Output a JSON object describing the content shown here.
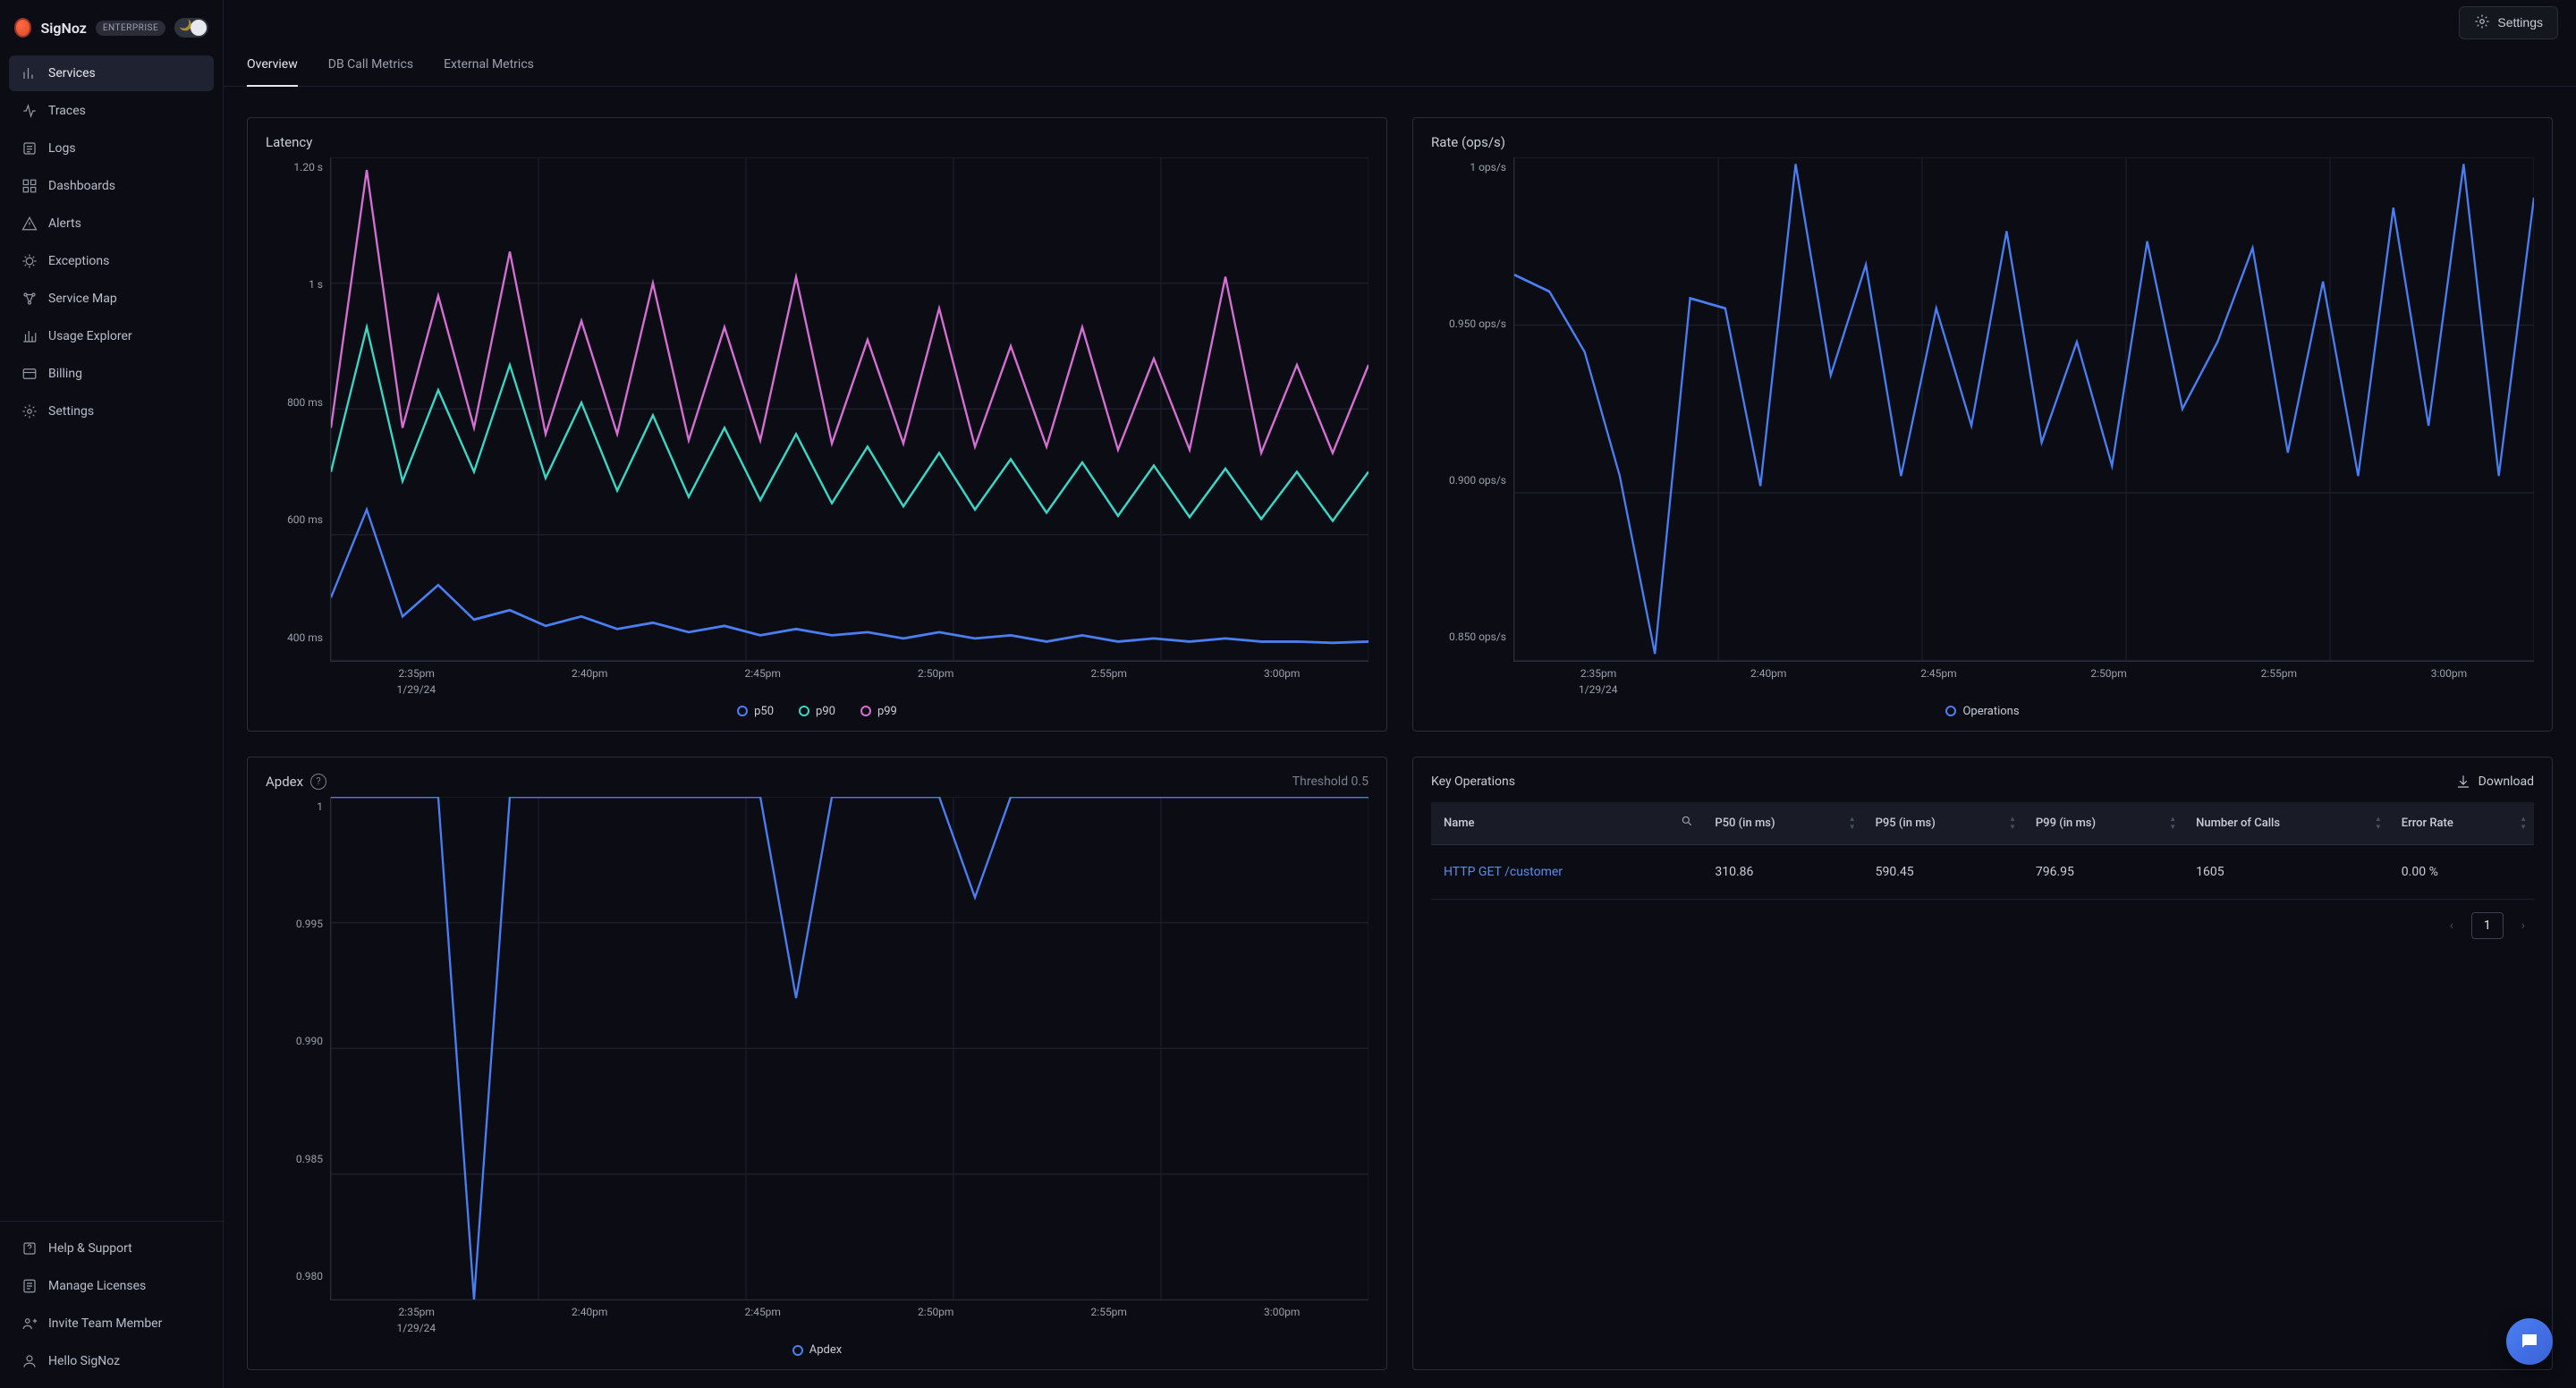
{
  "brand": {
    "name": "SigNoz",
    "badge": "ENTERPRISE"
  },
  "sidebar": {
    "items": [
      {
        "label": "Services",
        "icon": "bar-chart-icon",
        "active": true
      },
      {
        "label": "Traces",
        "icon": "traces-icon",
        "active": false
      },
      {
        "label": "Logs",
        "icon": "logs-icon",
        "active": false
      },
      {
        "label": "Dashboards",
        "icon": "grid-icon",
        "active": false
      },
      {
        "label": "Alerts",
        "icon": "alert-icon",
        "active": false
      },
      {
        "label": "Exceptions",
        "icon": "bug-icon",
        "active": false
      },
      {
        "label": "Service Map",
        "icon": "map-icon",
        "active": false
      },
      {
        "label": "Usage Explorer",
        "icon": "usage-icon",
        "active": false
      },
      {
        "label": "Billing",
        "icon": "billing-icon",
        "active": false
      },
      {
        "label": "Settings",
        "icon": "gear-icon",
        "active": false
      }
    ],
    "bottom": [
      {
        "label": "Help & Support",
        "icon": "help-icon"
      },
      {
        "label": "Manage Licenses",
        "icon": "license-icon"
      },
      {
        "label": "Invite Team Member",
        "icon": "invite-icon"
      },
      {
        "label": "Hello SigNoz",
        "icon": "hello-icon"
      }
    ]
  },
  "topbar": {
    "settings_label": "Settings"
  },
  "tabs": [
    {
      "label": "Overview",
      "active": true
    },
    {
      "label": "DB Call Metrics",
      "active": false
    },
    {
      "label": "External Metrics",
      "active": false
    }
  ],
  "latency": {
    "title": "Latency",
    "legend": [
      {
        "label": "p50",
        "color": "#4a7ff3"
      },
      {
        "label": "p90",
        "color": "#3bd6c6"
      },
      {
        "label": "p99",
        "color": "#d66fd4"
      }
    ]
  },
  "rate": {
    "title": "Rate (ops/s)",
    "legend": [
      {
        "label": "Operations",
        "color": "#4a7ff3"
      }
    ]
  },
  "apdex": {
    "title": "Apdex",
    "threshold_label": "Threshold 0.5",
    "legend": [
      {
        "label": "Apdex",
        "color": "#4a7ff3"
      }
    ]
  },
  "keyops": {
    "title": "Key Operations",
    "download_label": "Download",
    "columns": [
      "Name",
      "P50 (in ms)",
      "P95 (in ms)",
      "P99 (in ms)",
      "Number of Calls",
      "Error Rate"
    ],
    "rows": [
      {
        "name": "HTTP GET /customer",
        "p50": "310.86",
        "p95": "590.45",
        "p99": "796.95",
        "calls": "1605",
        "err": "0.00 %"
      }
    ],
    "page": "1"
  },
  "chart_data": [
    {
      "id": "latency",
      "type": "line",
      "title": "Latency",
      "xlabel": "",
      "ylabel": "",
      "yticks": [
        "1.20 s",
        "1 s",
        "800 ms",
        "600 ms",
        "400 ms"
      ],
      "ylim_ms": [
        400,
        1200
      ],
      "x": [
        "2:35pm",
        "2:40pm",
        "2:45pm",
        "2:50pm",
        "2:55pm",
        "3:00pm"
      ],
      "x_date": "1/29/24",
      "series": [
        {
          "name": "p50",
          "color": "#4a7ff3",
          "values_ms": [
            500,
            640,
            470,
            520,
            465,
            480,
            455,
            470,
            450,
            460,
            445,
            455,
            440,
            450,
            440,
            445,
            435,
            445,
            435,
            440,
            430,
            440,
            430,
            435,
            430,
            435,
            430,
            430,
            428,
            430
          ]
        },
        {
          "name": "p90",
          "color": "#3bd6c6",
          "values_ms": [
            700,
            930,
            685,
            830,
            700,
            870,
            690,
            810,
            670,
            790,
            660,
            770,
            655,
            760,
            650,
            740,
            645,
            730,
            640,
            720,
            635,
            715,
            630,
            710,
            628,
            705,
            625,
            700,
            622,
            700
          ]
        },
        {
          "name": "p99",
          "color": "#d66fd4",
          "values_ms": [
            770,
            1180,
            770,
            980,
            770,
            1050,
            760,
            940,
            760,
            1000,
            750,
            930,
            750,
            1010,
            745,
            910,
            745,
            960,
            740,
            900,
            740,
            930,
            735,
            880,
            735,
            1010,
            730,
            870,
            730,
            870
          ]
        }
      ]
    },
    {
      "id": "rate",
      "type": "line",
      "title": "Rate (ops/s)",
      "yticks": [
        "1 ops/s",
        "0.950 ops/s",
        "0.900 ops/s",
        "0.850 ops/s"
      ],
      "ylim": [
        0.85,
        1.0
      ],
      "x": [
        "2:35pm",
        "2:40pm",
        "2:45pm",
        "2:50pm",
        "2:55pm",
        "3:00pm"
      ],
      "x_date": "1/29/24",
      "series": [
        {
          "name": "Operations",
          "color": "#4a7ff3",
          "values": [
            0.965,
            0.96,
            0.942,
            0.905,
            0.852,
            0.958,
            0.955,
            0.902,
            0.998,
            0.935,
            0.968,
            0.905,
            0.955,
            0.92,
            0.978,
            0.915,
            0.945,
            0.908,
            0.975,
            0.925,
            0.945,
            0.973,
            0.912,
            0.963,
            0.905,
            0.985,
            0.92,
            0.998,
            0.905,
            0.988
          ]
        }
      ]
    },
    {
      "id": "apdex",
      "type": "line",
      "title": "Apdex",
      "threshold": 0.5,
      "yticks": [
        "1",
        "0.995",
        "0.990",
        "0.985",
        "0.980"
      ],
      "ylim": [
        0.98,
        1.0
      ],
      "x": [
        "2:35pm",
        "2:40pm",
        "2:45pm",
        "2:50pm",
        "2:55pm",
        "3:00pm"
      ],
      "x_date": "1/29/24",
      "series": [
        {
          "name": "Apdex",
          "color": "#4a7ff3",
          "values": [
            1.0,
            1.0,
            1.0,
            1.0,
            0.98,
            1.0,
            1.0,
            1.0,
            1.0,
            1.0,
            1.0,
            1.0,
            1.0,
            0.992,
            1.0,
            1.0,
            1.0,
            1.0,
            0.996,
            1.0,
            1.0,
            1.0,
            1.0,
            1.0,
            1.0,
            1.0,
            1.0,
            1.0,
            1.0,
            1.0
          ]
        }
      ]
    }
  ]
}
